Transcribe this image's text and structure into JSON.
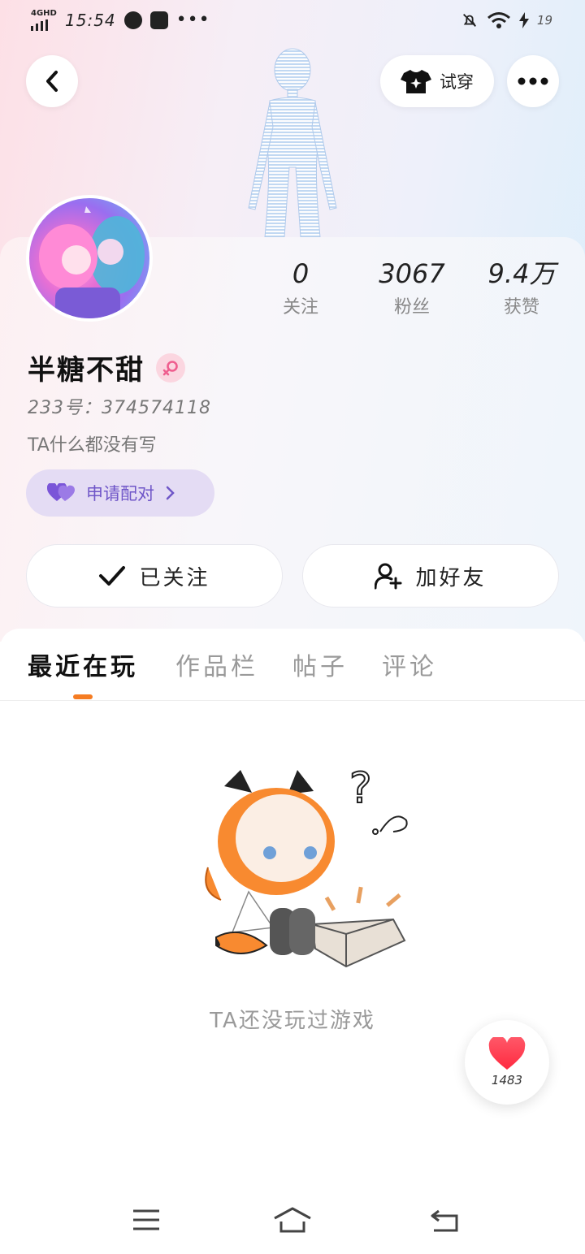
{
  "status_bar": {
    "network": "4GHD",
    "time": "15:54",
    "more": "•••",
    "battery": "19"
  },
  "header": {
    "tryon_label": "试穿"
  },
  "profile": {
    "nickname": "半糖不甜",
    "gender": "female",
    "id_label": "233号：",
    "id_value": "374574118",
    "bio": "TA什么都没有写",
    "pair_button": "申请配对"
  },
  "stats": [
    {
      "value": "0",
      "label": "关注"
    },
    {
      "value": "3067",
      "label": "粉丝"
    },
    {
      "value": "9.4万",
      "label": "获赞"
    }
  ],
  "actions": {
    "followed_label": "已关注",
    "add_friend_label": "加好友"
  },
  "tabs": [
    {
      "label": "最近在玩",
      "active": true
    },
    {
      "label": "作品栏",
      "active": false
    },
    {
      "label": "帖子",
      "active": false
    },
    {
      "label": "评论",
      "active": false
    }
  ],
  "empty_state": {
    "text": "TA还没玩过游戏"
  },
  "like": {
    "count": "1483"
  },
  "colors": {
    "accent_orange": "#f57c22",
    "pair_purple": "#6f56c8",
    "like_red": "#ff3b4e"
  },
  "icons": [
    "back-arrow-icon",
    "tshirt-icon",
    "more-dots-icon",
    "heart-icon",
    "chevron-right-icon",
    "check-icon",
    "add-user-icon",
    "female-icon",
    "menu-icon",
    "home-icon",
    "return-icon"
  ]
}
